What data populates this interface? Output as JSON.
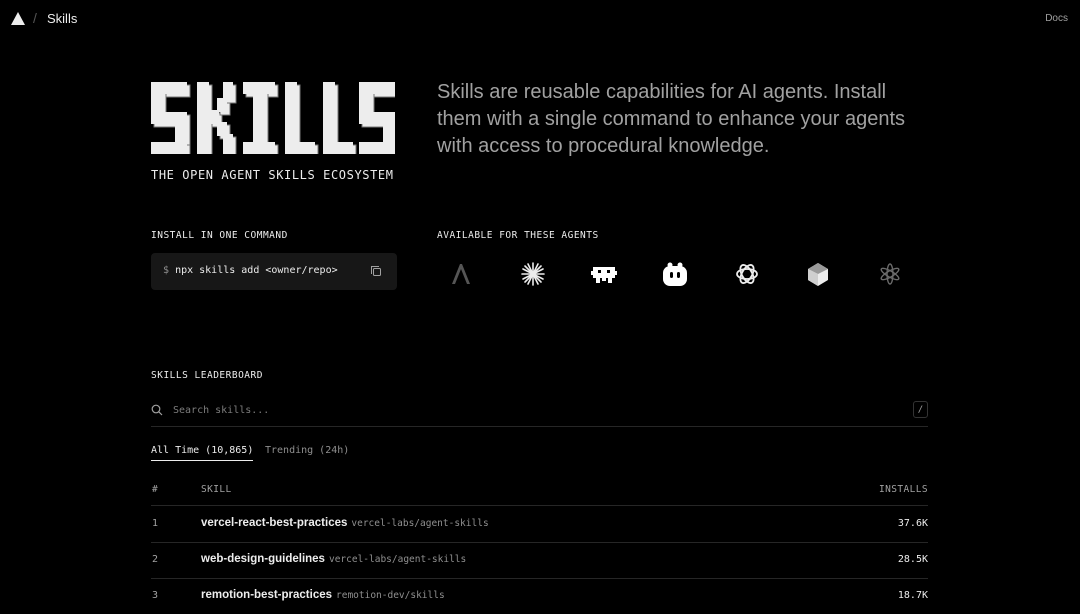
{
  "header": {
    "crumb": "Skills",
    "docs": "Docs"
  },
  "hero": {
    "logo_text": "SKILLS",
    "subtitle": "THE OPEN AGENT SKILLS ECOSYSTEM",
    "description": "Skills are reusable capabilities for AI agents. Install them with a single command to enhance your agents with access to procedural knowledge."
  },
  "install": {
    "label": "INSTALL IN ONE COMMAND",
    "prompt": "$",
    "command": "npx skills add <owner/repo>"
  },
  "agents": {
    "label": "AVAILABLE FOR THESE AGENTS",
    "icons": [
      "amp-icon",
      "claude-icon",
      "goose-icon",
      "copilot-icon",
      "openai-icon",
      "cursor-icon",
      "sparkle-icon"
    ]
  },
  "leaderboard": {
    "label": "SKILLS LEADERBOARD",
    "search_placeholder": "Search skills...",
    "shortcut": "/",
    "tabs": [
      {
        "label": "All Time (10,865)",
        "active": true
      },
      {
        "label": "Trending (24h)",
        "active": false
      }
    ],
    "columns": {
      "rank": "#",
      "skill": "SKILL",
      "installs": "INSTALLS"
    },
    "rows": [
      {
        "rank": "1",
        "name": "vercel-react-best-practices",
        "source": "vercel-labs/agent-skills",
        "installs": "37.6K"
      },
      {
        "rank": "2",
        "name": "web-design-guidelines",
        "source": "vercel-labs/agent-skills",
        "installs": "28.5K"
      },
      {
        "rank": "3",
        "name": "remotion-best-practices",
        "source": "remotion-dev/skills",
        "installs": "18.7K"
      }
    ]
  },
  "colors": {
    "background": "#000000",
    "text": "#ededed",
    "muted": "#a1a1a1",
    "panel": "#171717",
    "border": "#262626"
  }
}
